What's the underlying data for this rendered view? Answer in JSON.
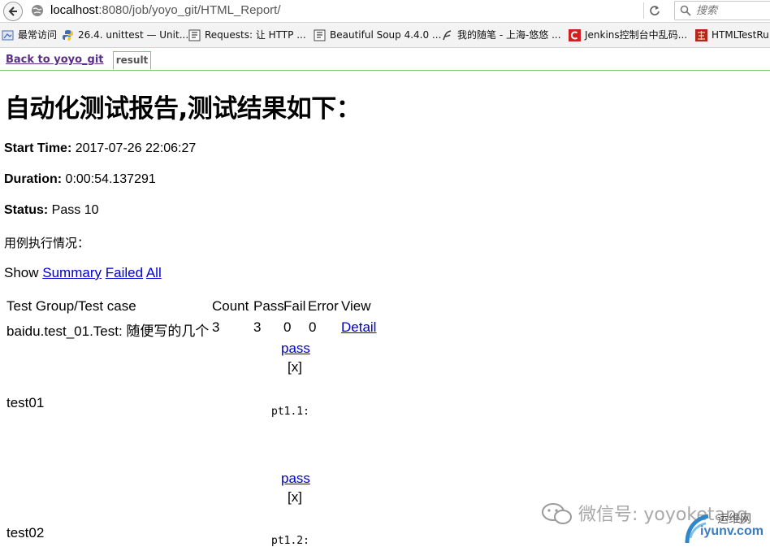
{
  "browser": {
    "url_host": "localhost",
    "url_rest": ":8080/job/yoyo_git/HTML_Report/",
    "search_placeholder": "搜索"
  },
  "bookmarks": [
    {
      "label": "最常访问",
      "icon": "bookmark-folder-icon"
    },
    {
      "label": "26.4. unittest — Unit...",
      "icon": "python-icon"
    },
    {
      "label": "Requests: 让 HTTP ...",
      "icon": "page-icon"
    },
    {
      "label": "Beautiful Soup 4.4.0 ...",
      "icon": "page-icon"
    },
    {
      "label": "我的随笔 - 上海-悠悠 ...",
      "icon": "blog-icon"
    },
    {
      "label": "Jenkins控制台中乱码...",
      "icon": "red-c-icon"
    },
    {
      "label": "HTMLTestRu",
      "icon": "red-icon"
    }
  ],
  "tabs": {
    "back_label": "Back to yoyo_git",
    "result_label": "result"
  },
  "report": {
    "title": "自动化测试报告,测试结果如下：",
    "start_time_label": "Start Time:",
    "start_time_value": " 2017-07-26 22:06:27",
    "duration_label": "Duration:",
    "duration_value": " 0:00:54.137291",
    "status_label": "Status:",
    "status_value": " Pass 10",
    "exec_label": "用例执行情况：",
    "show_label": "Show",
    "show_summary": "Summary",
    "show_failed": "Failed",
    "show_all": "All"
  },
  "table": {
    "headers": [
      "Test Group/Test case",
      "Count",
      "Pass",
      "Fail",
      "Error",
      "View"
    ],
    "group": {
      "name": "baidu.test_01.Test: 随便写的几个",
      "count": "3",
      "pass": "3",
      "fail": "0",
      "error": "0",
      "view": "Detail"
    },
    "cases": [
      {
        "name": "test01",
        "status": "pass",
        "close": "[x]",
        "output": "pt1.1:"
      },
      {
        "name": "test02",
        "status": "pass",
        "close": "[x]",
        "output": "pt1.2:"
      }
    ]
  },
  "watermark": {
    "wechat": "微信号: yoyoketang",
    "site_cn": "运维网",
    "site_url": "iyunv.com"
  }
}
